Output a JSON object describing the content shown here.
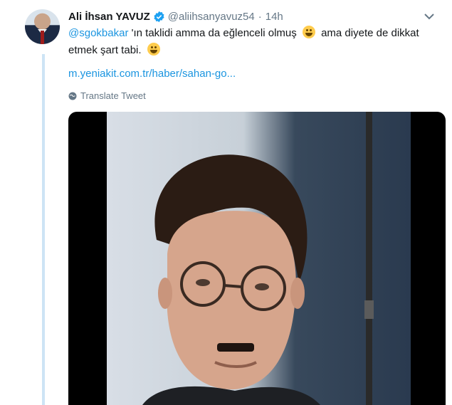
{
  "tweet": {
    "author_name": "Ali İhsan YAVUZ",
    "handle": "@aliihsanyavuz54",
    "separator": "·",
    "time": "14h",
    "mention": "@sgokbakar",
    "text_part1": " 'ın taklidi amma da eğlenceli olmuş ",
    "text_part2": "  ama diyete de dikkat etmek şart tabi. ",
    "link": "m.yeniakit.com.tr/haber/sahan-go...",
    "translate_label": "Translate Tweet"
  },
  "icons": {
    "verified": "verified-badge-icon",
    "caret": "chevron-down-icon",
    "globe": "globe-icon",
    "emoji1": "rofl-emoji",
    "emoji2": "wink-emoji"
  },
  "colors": {
    "link": "#1b95e0",
    "muted": "#657786",
    "thread_line": "#cde4f5"
  }
}
